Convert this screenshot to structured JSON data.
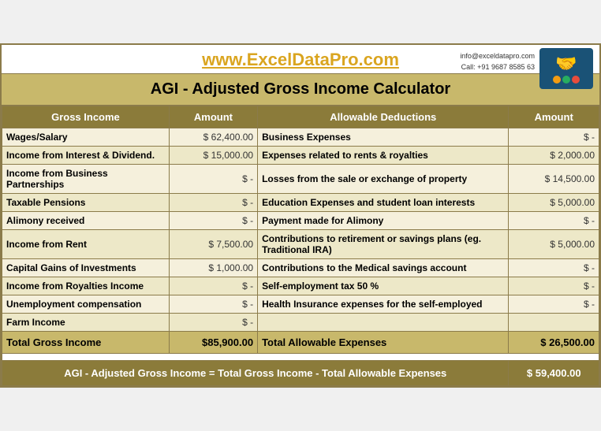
{
  "header": {
    "site_url": "www.ExcelDataPro.com",
    "info_email": "info@exceldatapro.com",
    "info_call": "Call: +91 9687 8585 63",
    "app_title": "AGI - Adjusted Gross Income Calculator"
  },
  "table": {
    "col_headers": {
      "gross_income": "Gross Income",
      "amount1": "Amount",
      "allowable_deductions": "Allowable Deductions",
      "amount2": "Amount"
    },
    "rows": [
      {
        "income_label": "Wages/Salary",
        "income_currency": "$",
        "income_amount": "62,400.00",
        "deduction_label": "Business Expenses",
        "deduction_currency": "$",
        "deduction_amount": "-"
      },
      {
        "income_label": "Income from Interest & Dividend.",
        "income_currency": "$",
        "income_amount": "15,000.00",
        "deduction_label": "Expenses related to rents & royalties",
        "deduction_currency": "$",
        "deduction_amount": "2,000.00"
      },
      {
        "income_label": "Income from Business Partnerships",
        "income_currency": "$",
        "income_amount": "-",
        "deduction_label": "Losses from the sale or exchange of property",
        "deduction_currency": "$",
        "deduction_amount": "14,500.00"
      },
      {
        "income_label": "Taxable Pensions",
        "income_currency": "$",
        "income_amount": "-",
        "deduction_label": "Education Expenses and student loan interests",
        "deduction_currency": "$",
        "deduction_amount": "5,000.00"
      },
      {
        "income_label": "Alimony received",
        "income_currency": "$",
        "income_amount": "-",
        "deduction_label": "Payment made for Alimony",
        "deduction_currency": "$",
        "deduction_amount": "-"
      },
      {
        "income_label": "Income from Rent",
        "income_currency": "$",
        "income_amount": "7,500.00",
        "deduction_label": "Contributions to retirement or savings plans (eg. Traditional IRA)",
        "deduction_currency": "$",
        "deduction_amount": "5,000.00"
      },
      {
        "income_label": "Capital Gains of Investments",
        "income_currency": "$",
        "income_amount": "1,000.00",
        "deduction_label": "Contributions to the Medical savings account",
        "deduction_currency": "$",
        "deduction_amount": "-"
      },
      {
        "income_label": "Income from Royalties Income",
        "income_currency": "$",
        "income_amount": "-",
        "deduction_label": "Self-employment tax 50 %",
        "deduction_currency": "$",
        "deduction_amount": "-"
      },
      {
        "income_label": "Unemployment compensation",
        "income_currency": "$",
        "income_amount": "-",
        "deduction_label": "Health Insurance expenses for the self-employed",
        "deduction_currency": "$",
        "deduction_amount": "-"
      },
      {
        "income_label": "Farm Income",
        "income_currency": "$",
        "income_amount": "-",
        "deduction_label": "",
        "deduction_currency": "",
        "deduction_amount": ""
      }
    ],
    "total_row": {
      "total_gross_label": "Total Gross Income",
      "total_gross_currency": "$",
      "total_gross_amount": "85,900.00",
      "total_deductions_label": "Total Allowable Expenses",
      "total_deductions_currency": "$",
      "total_deductions_amount": "26,500.00"
    },
    "agi_row": {
      "label": "AGI - Adjusted Gross Income = Total Gross Income - Total Allowable Expenses",
      "currency": "$",
      "amount": "59,400.00"
    }
  }
}
